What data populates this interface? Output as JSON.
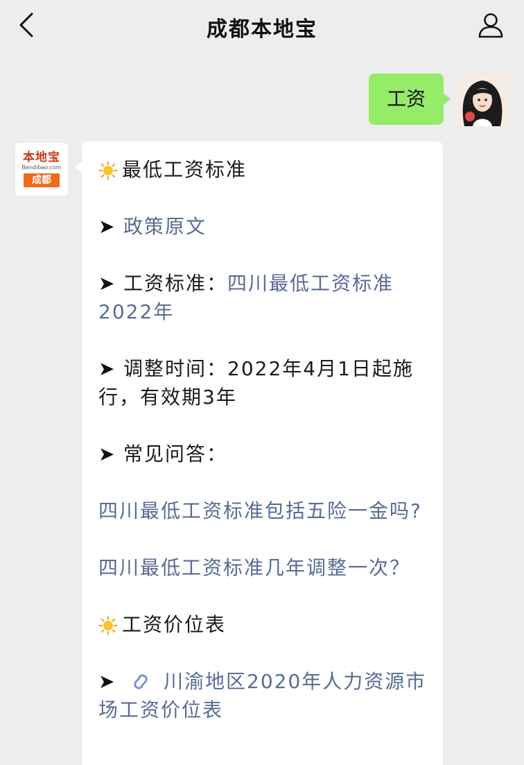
{
  "header": {
    "title": "成都本地宝"
  },
  "user_message": {
    "text": "工资"
  },
  "bot": {
    "avatar": {
      "brand": "本地宝",
      "domain": "Bendibao.com",
      "city": "成都"
    },
    "arrow_glyph": "➤",
    "section1_title": "最低工资标准",
    "policy_link": "政策原文",
    "standard_label": "工资标准：",
    "standard_link": "四川最低工资标准2022年",
    "adjust_text": "调整时间：2022年4月1日起施行，有效期3年",
    "faq_label": "常见问答：",
    "faq1_link": "四川最低工资标准包括五险一金吗?",
    "faq2_link": "四川最低工资标准几年调整一次？",
    "section2_title": "工资价位表",
    "price_table_link": "川渝地区2020年人力资源市场工资价位表"
  },
  "colors": {
    "background": "#ededed",
    "user_bubble": "#95ec69",
    "bot_bubble": "#ffffff",
    "link": "#576b95",
    "brand_orange": "#ef6a1b"
  },
  "icons": [
    "back-chevron-icon",
    "profile-icon",
    "sun-icon",
    "arrow-icon",
    "link-icon"
  ]
}
